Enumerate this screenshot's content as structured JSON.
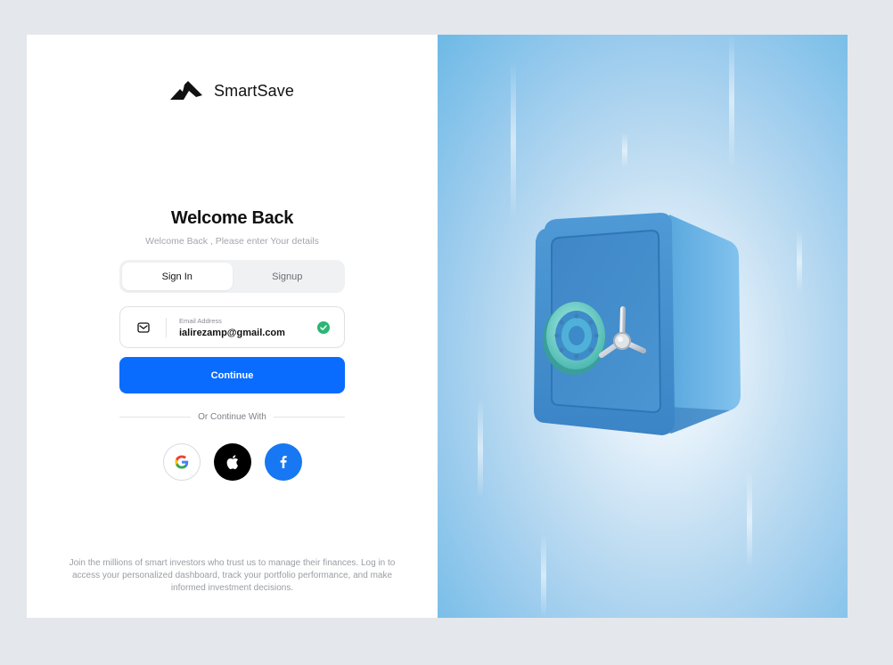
{
  "brand": {
    "name": "SmartSave"
  },
  "auth": {
    "title": "Welcome Back",
    "subtitle": "Welcome Back , Please enter Your details",
    "tabs": [
      {
        "label": "Sign In",
        "active": true
      },
      {
        "label": "Signup",
        "active": false
      }
    ],
    "email": {
      "label": "Email Address",
      "value": "ialirezamp@gmail.com",
      "valid": true
    },
    "continue_label": "Continue",
    "divider_label": "Or Continue With",
    "socials": [
      {
        "name": "google",
        "icon": "google-icon"
      },
      {
        "name": "apple",
        "icon": "apple-icon"
      },
      {
        "name": "facebook",
        "icon": "facebook-icon"
      }
    ],
    "footer": "Join the millions of smart investors who trust us to manage their finances. Log in to access your personalized dashboard, track your portfolio performance, and make informed investment decisions."
  },
  "illustration": {
    "icon": "safe-vault-illustration"
  },
  "colors": {
    "primary": "#0a6cff",
    "success": "#2bb673",
    "facebook": "#1877f2",
    "safe_blue": "#4a93d0",
    "dial_teal": "#6fd0c8"
  }
}
